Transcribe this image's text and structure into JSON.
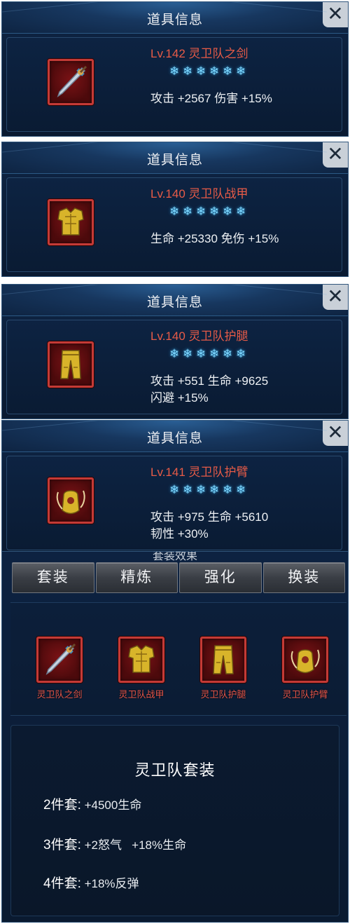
{
  "panels": [
    {
      "header": "道具信息",
      "close": "✕",
      "icon": "sword-icon",
      "name": "Lv.142 灵卫队之剑",
      "stars": 6,
      "stats": [
        "攻击 +2567  伤害 +15%"
      ]
    },
    {
      "header": "道具信息",
      "close": "✕",
      "icon": "armor-icon",
      "name": "Lv.140 灵卫队战甲",
      "stars": 6,
      "stats": [
        "生命 +25330  免伤 +15%"
      ]
    },
    {
      "header": "道具信息",
      "close": "✕",
      "icon": "leggings-icon",
      "name": "Lv.140 灵卫队护腿",
      "stars": 6,
      "stats": [
        "攻击 +551  生命 +9625",
        "闪避 +15%"
      ]
    },
    {
      "header": "道具信息",
      "close": "✕",
      "icon": "bracer-icon",
      "name": "Lv.141 灵卫队护臂",
      "stars": 6,
      "stats": [
        "攻击 +975  生命 +5610",
        "韧性 +30%"
      ]
    }
  ],
  "set_panel": {
    "caption": "套装效果",
    "tabs": [
      "套装",
      "精炼",
      "强化",
      "换装"
    ],
    "items": [
      {
        "label": "灵卫队之剑",
        "icon": "sword-icon"
      },
      {
        "label": "灵卫队战甲",
        "icon": "armor-icon"
      },
      {
        "label": "灵卫队护腿",
        "icon": "leggings-icon"
      },
      {
        "label": "灵卫队护臂",
        "icon": "bracer-icon"
      }
    ],
    "bonus_title": "灵卫队套装",
    "bonuses": [
      {
        "count": "2件套:",
        "text": "+4500生命"
      },
      {
        "count": "3件套:",
        "text": "+2怒气   +18%生命"
      },
      {
        "count": "4件套:",
        "text": "+18%反弹"
      }
    ]
  },
  "colors": {
    "item_name": "#e75b47",
    "star": "#7fd9ff",
    "panel_bg": "#0b1d37",
    "icon_border": "#c43a36"
  }
}
